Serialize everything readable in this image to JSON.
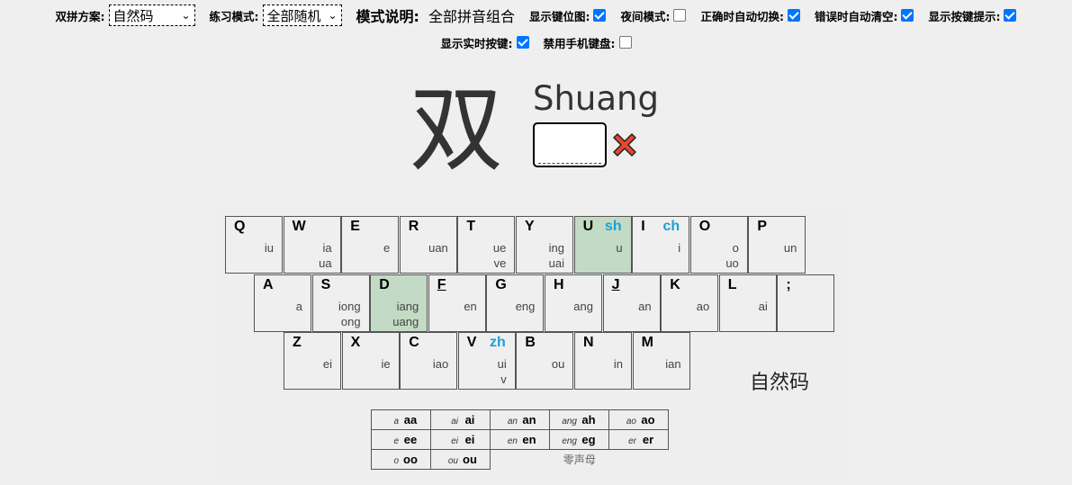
{
  "settings": {
    "scheme": {
      "label": "双拼方案:",
      "value": "自然码"
    },
    "practice_mode": {
      "label": "练习模式:",
      "value": "全部随机"
    },
    "mode_desc": {
      "label": "模式说明:",
      "value": "全部拼音组合"
    },
    "checkboxes_row1": [
      {
        "label": "显示键位图:",
        "checked": true
      },
      {
        "label": "夜间模式:",
        "checked": false
      },
      {
        "label": "正确时自动切换:",
        "checked": true
      },
      {
        "label": "错误时自动清空:",
        "checked": true
      },
      {
        "label": "显示按键提示:",
        "checked": true
      }
    ],
    "checkboxes_row2": [
      {
        "label": "显示实时按键:",
        "checked": true
      },
      {
        "label": "禁用手机键盘:",
        "checked": false
      }
    ]
  },
  "practice": {
    "hanzi": "双",
    "pinyin": "Shuang",
    "input_value": "",
    "result_icon": "wrong-x-icon"
  },
  "keyboard": {
    "rows": [
      [
        {
          "key": "Q",
          "shengmu": "",
          "finals": [
            "iu"
          ],
          "highlight": false
        },
        {
          "key": "W",
          "shengmu": "",
          "finals": [
            "ia",
            "ua"
          ],
          "highlight": false
        },
        {
          "key": "E",
          "shengmu": "",
          "finals": [
            "e"
          ],
          "highlight": false
        },
        {
          "key": "R",
          "shengmu": "",
          "finals": [
            "uan"
          ],
          "highlight": false
        },
        {
          "key": "T",
          "shengmu": "",
          "finals": [
            "ue",
            "ve"
          ],
          "highlight": false
        },
        {
          "key": "Y",
          "shengmu": "",
          "finals": [
            "ing",
            "uai"
          ],
          "highlight": false
        },
        {
          "key": "U",
          "shengmu": "sh",
          "finals": [
            "u"
          ],
          "highlight": true
        },
        {
          "key": "I",
          "shengmu": "ch",
          "finals": [
            "i"
          ],
          "highlight": false
        },
        {
          "key": "O",
          "shengmu": "",
          "finals": [
            "o",
            "uo"
          ],
          "highlight": false
        },
        {
          "key": "P",
          "shengmu": "",
          "finals": [
            "un"
          ],
          "highlight": false
        }
      ],
      [
        {
          "key": "A",
          "shengmu": "",
          "finals": [
            "a"
          ],
          "highlight": false
        },
        {
          "key": "S",
          "shengmu": "",
          "finals": [
            "iong",
            "ong"
          ],
          "highlight": false
        },
        {
          "key": "D",
          "shengmu": "",
          "finals": [
            "iang",
            "uang"
          ],
          "highlight": true
        },
        {
          "key": "F",
          "shengmu": "",
          "finals": [
            "en"
          ],
          "highlight": false,
          "underline": true
        },
        {
          "key": "G",
          "shengmu": "",
          "finals": [
            "eng"
          ],
          "highlight": false
        },
        {
          "key": "H",
          "shengmu": "",
          "finals": [
            "ang"
          ],
          "highlight": false
        },
        {
          "key": "J",
          "shengmu": "",
          "finals": [
            "an"
          ],
          "highlight": false,
          "underline": true
        },
        {
          "key": "K",
          "shengmu": "",
          "finals": [
            "ao"
          ],
          "highlight": false
        },
        {
          "key": "L",
          "shengmu": "",
          "finals": [
            "ai"
          ],
          "highlight": false
        },
        {
          "key": ";",
          "shengmu": "",
          "finals": [],
          "highlight": false
        }
      ],
      [
        {
          "key": "Z",
          "shengmu": "",
          "finals": [
            "ei"
          ],
          "highlight": false
        },
        {
          "key": "X",
          "shengmu": "",
          "finals": [
            "ie"
          ],
          "highlight": false
        },
        {
          "key": "C",
          "shengmu": "",
          "finals": [
            "iao"
          ],
          "highlight": false
        },
        {
          "key": "V",
          "shengmu": "zh",
          "finals": [
            "ui",
            "v"
          ],
          "highlight": false
        },
        {
          "key": "B",
          "shengmu": "",
          "finals": [
            "ou"
          ],
          "highlight": false
        },
        {
          "key": "N",
          "shengmu": "",
          "finals": [
            "in"
          ],
          "highlight": false
        },
        {
          "key": "M",
          "shengmu": "",
          "finals": [
            "ian"
          ],
          "highlight": false
        }
      ]
    ],
    "scheme_name": "自然码"
  },
  "zero_initials": {
    "rows": [
      [
        {
          "final": "a",
          "keys": "aa"
        },
        {
          "final": "ai",
          "keys": "ai"
        },
        {
          "final": "an",
          "keys": "an"
        },
        {
          "final": "ang",
          "keys": "ah"
        },
        {
          "final": "ao",
          "keys": "ao"
        }
      ],
      [
        {
          "final": "e",
          "keys": "ee"
        },
        {
          "final": "ei",
          "keys": "ei"
        },
        {
          "final": "en",
          "keys": "en"
        },
        {
          "final": "eng",
          "keys": "eg"
        },
        {
          "final": "er",
          "keys": "er"
        }
      ],
      [
        {
          "final": "o",
          "keys": "oo"
        },
        {
          "final": "ou",
          "keys": "ou"
        }
      ]
    ],
    "label": "零声母"
  }
}
